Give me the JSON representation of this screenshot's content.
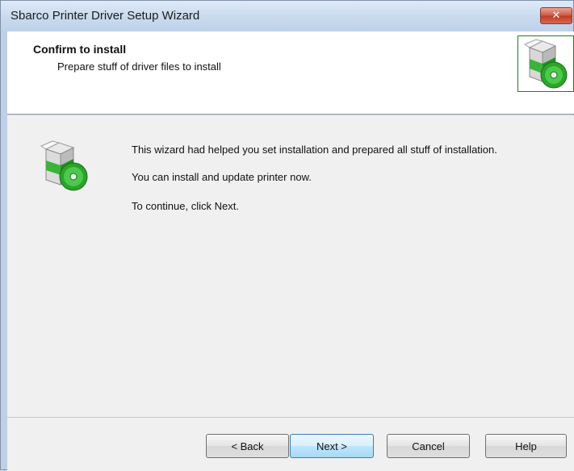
{
  "window": {
    "title": "Sbarco Printer Driver Setup Wizard",
    "close_label": "✕"
  },
  "header": {
    "title": "Confirm to install",
    "subtitle": "Prepare stuff of driver files to install",
    "icon": "installer-package-icon"
  },
  "content": {
    "icon": "installer-package-icon",
    "line1": "This wizard had helped you set installation and prepared all stuff of installation.",
    "line2": "You can install and update printer now.",
    "line3": "To continue, click Next."
  },
  "buttons": {
    "back": "< Back",
    "next": "Next >",
    "cancel": "Cancel",
    "help": "Help"
  },
  "colors": {
    "accent_green": "#2ea82e",
    "primary_button_border": "#3c7fb1",
    "close_button": "#c9432c"
  }
}
